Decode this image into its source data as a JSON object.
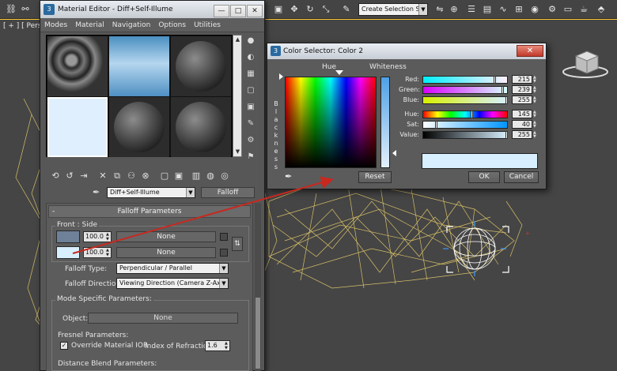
{
  "main_toolbar": {
    "selection_set_placeholder": "Create Selection Se",
    "icons": [
      "link-icon",
      "unlink-icon",
      "bind-icon",
      "select-icon",
      "select-by-name-icon",
      "rect-region-icon",
      "window-crossing-icon",
      "move-icon",
      "rotate-icon",
      "scale-icon",
      "reference-coord-icon",
      "pivot-icon",
      "select-manipulate-icon",
      "keyboard-shortcut-icon",
      "snaps-toggle-icon",
      "angle-snap-icon",
      "percent-snap-icon",
      "spinner-snap-icon",
      "edit-named-sets-icon",
      "mirror-icon",
      "align-icon",
      "layer-manager-icon",
      "graphite-tools-icon",
      "curve-editor-icon",
      "schematic-view-icon",
      "material-editor-icon",
      "render-setup-icon",
      "rendered-frame-icon",
      "render-icon",
      "teapot-icon"
    ]
  },
  "viewport": {
    "label": "[ + ] [ Persp",
    "accent": "#ffcc33"
  },
  "material_editor": {
    "title": "Material Editor - Diff+Self-Illume",
    "menu": [
      "Modes",
      "Material",
      "Navigation",
      "Options",
      "Utilities"
    ],
    "material_name": "Diff+Self-Illume",
    "material_type": "Falloff",
    "falloff": {
      "rollout_title": "Falloff Parameters",
      "front_side_label": "Front : Side",
      "front_amount": "100.0",
      "side_amount": "100.0",
      "front_map": "None",
      "side_map": "None",
      "front_color": "#6e8198",
      "side_color": "#d7effe",
      "falloff_type_label": "Falloff Type:",
      "falloff_type_value": "Perpendicular / Parallel",
      "falloff_direction_label": "Falloff Direction:",
      "falloff_direction_value": "Viewing Direction (Camera Z-Axis)"
    },
    "mode_specific": {
      "group_label": "Mode Specific Parameters:",
      "object_label": "Object:",
      "object_value": "None",
      "fresnel_label": "Fresnel Parameters:",
      "override_ior_label": "Override Material IOR",
      "override_ior_checked": true,
      "index_refraction_label": "Index of Refraction",
      "index_refraction_value": "1.6",
      "distance_blend_label": "Distance Blend Parameters:"
    }
  },
  "color_selector": {
    "title": "Color Selector: Color 2",
    "hue_label": "Hue",
    "whiteness_label": "Whiteness",
    "blackness_label": "Blackness",
    "channels": [
      {
        "label": "Red:",
        "value": "215"
      },
      {
        "label": "Green:",
        "value": "239"
      },
      {
        "label": "Blue:",
        "value": "255"
      },
      {
        "label": "Hue:",
        "value": "145"
      },
      {
        "label": "Sat:",
        "value": "40"
      },
      {
        "label": "Value:",
        "value": "255"
      }
    ],
    "preview_color": "#d7effe",
    "reset_label": "Reset",
    "ok_label": "OK",
    "cancel_label": "Cancel"
  }
}
